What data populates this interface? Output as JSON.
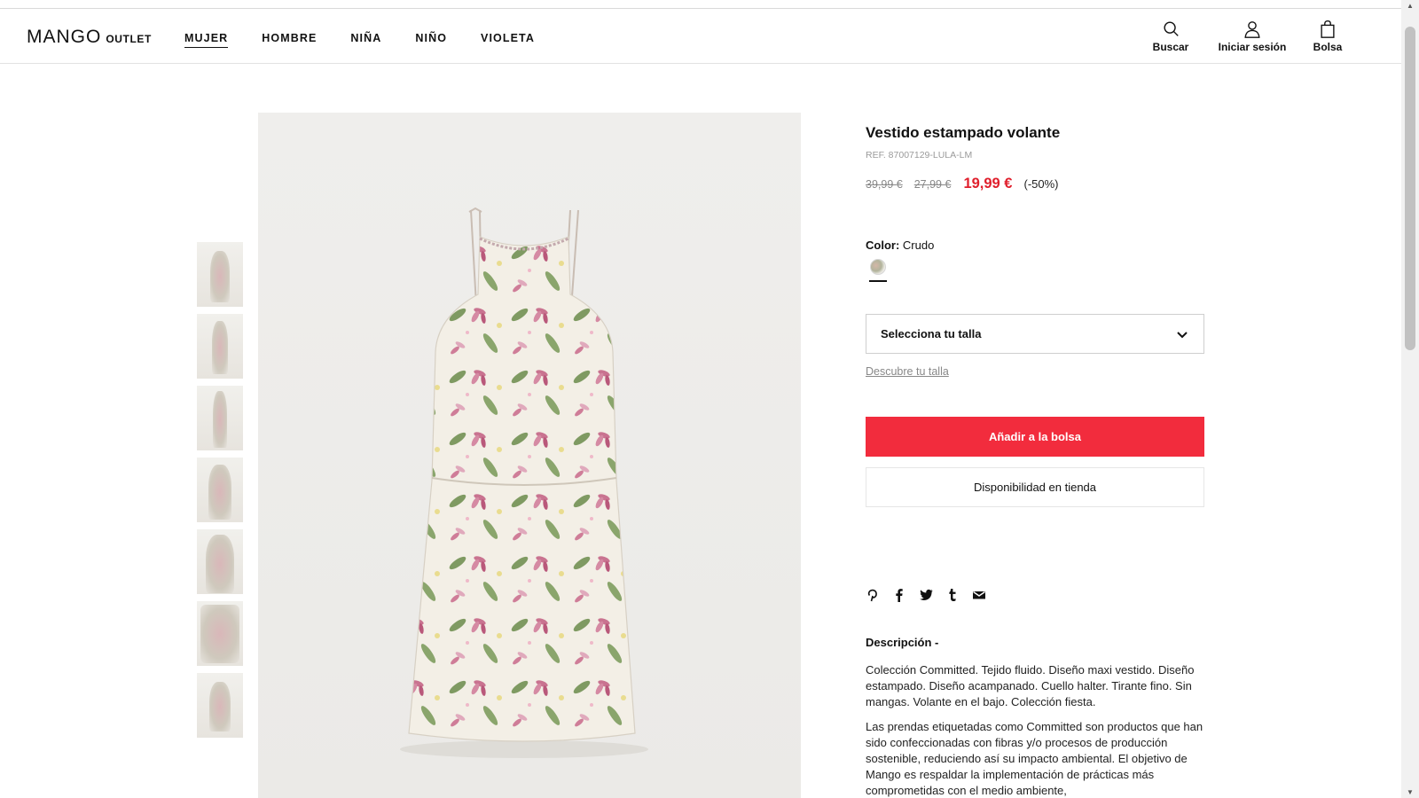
{
  "header": {
    "logo": "MANGO",
    "logo_sub": "OUTLET",
    "nav": [
      "MUJER",
      "HOMBRE",
      "NIÑA",
      "NIÑO",
      "VIOLETA"
    ],
    "actions": {
      "search": "Buscar",
      "login": "Iniciar sesión",
      "bag": "Bolsa"
    }
  },
  "gallery": {
    "thumbnail_count": 7,
    "main_image": "flower-print-halter-dress"
  },
  "product": {
    "title": "Vestido estampado volante",
    "ref": "REF. 87007129-LULA-LM",
    "price_original": "39,99 €",
    "price_previous": "27,99 €",
    "price_current": "19,99 €",
    "discount": "(-50%)",
    "color_label": "Color:",
    "color_value": "Crudo",
    "size_placeholder": "Selecciona tu talla",
    "size_guide_link": "Descubre tu talla",
    "add_button": "Añadir a la bolsa",
    "store_button": "Disponibilidad en tienda"
  },
  "share_icons": [
    "pinterest-icon",
    "facebook-icon",
    "twitter-icon",
    "tumblr-icon",
    "mail-icon"
  ],
  "description": {
    "title": "Descripción -",
    "paragraph1": "Colección Committed. Tejido fluido. Diseño maxi vestido. Diseño estampado. Diseño acampanado. Cuello halter. Tirante fino. Sin mangas. Volante en el bajo. Colección fiesta.",
    "paragraph2": "Las prendas etiquetadas como Committed son productos que han sido confeccionadas con fibras y/o procesos de producción sostenible, reduciendo así su impacto ambiental. El objetivo de Mango es respaldar la implementación de prácticas más comprometidas con el medio ambiente,"
  },
  "colors": {
    "accent_red": "#f22c3d",
    "price_red": "#e01f2c"
  }
}
